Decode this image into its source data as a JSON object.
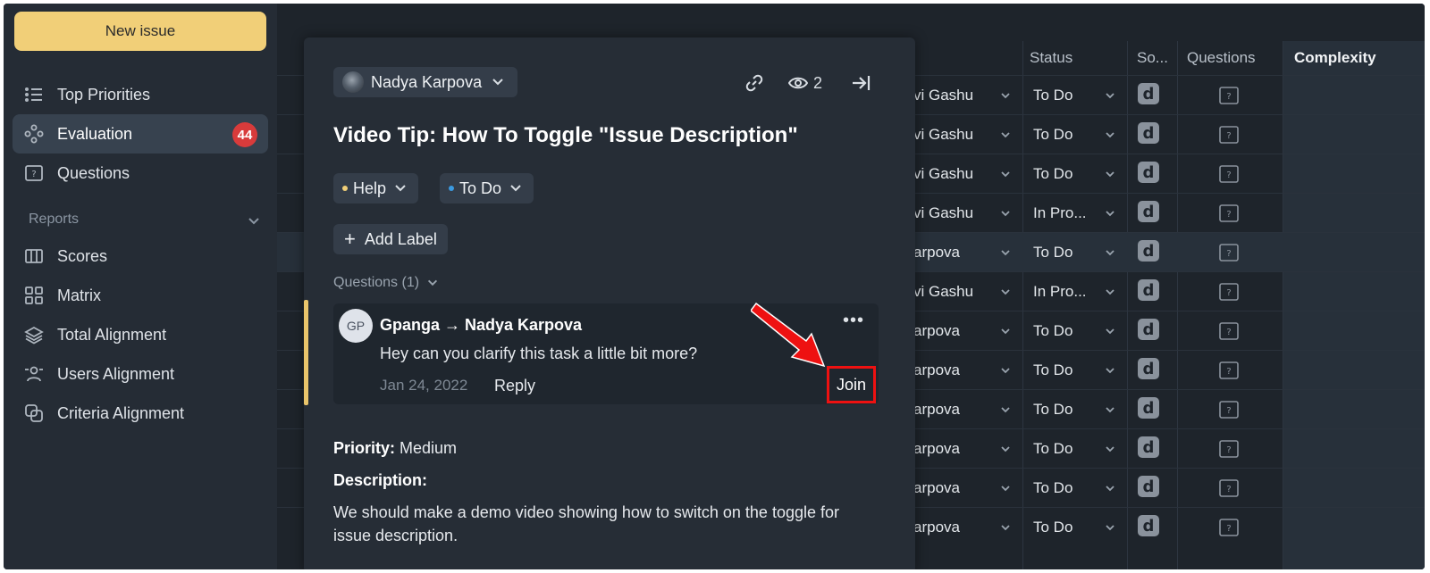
{
  "sidebar": {
    "new_issue_label": "New issue",
    "items": [
      {
        "label": "Top Priorities",
        "icon": "list-icon"
      },
      {
        "label": "Evaluation",
        "icon": "gamepad-icon",
        "badge": "44",
        "active": true
      },
      {
        "label": "Questions",
        "icon": "question-box-icon"
      }
    ],
    "reports_label": "Reports",
    "report_items": [
      {
        "label": "Scores",
        "icon": "columns-icon"
      },
      {
        "label": "Matrix",
        "icon": "grid-icon"
      },
      {
        "label": "Total Alignment",
        "icon": "layers-icon"
      },
      {
        "label": "Users Alignment",
        "icon": "users-icon"
      },
      {
        "label": "Criteria Alignment",
        "icon": "overlap-icon"
      }
    ]
  },
  "table": {
    "headers": {
      "status": "Status",
      "source": "So...",
      "questions": "Questions",
      "complexity": "Complexity"
    },
    "rows": [
      {
        "assignee": "vi Gashu",
        "status": "To Do",
        "source": "d"
      },
      {
        "assignee": "vi Gashu",
        "status": "To Do",
        "source": "d"
      },
      {
        "assignee": "vi Gashu",
        "status": "To Do",
        "source": "d"
      },
      {
        "assignee": "vi Gashu",
        "status": "In Pro...",
        "source": "d"
      },
      {
        "assignee": "arpova",
        "status": "To Do",
        "source": "d",
        "highlight": true
      },
      {
        "assignee": "vi Gashu",
        "status": "In Pro...",
        "source": "d"
      },
      {
        "assignee": "arpova",
        "status": "To Do",
        "source": "d"
      },
      {
        "assignee": "arpova",
        "status": "To Do",
        "source": "d"
      },
      {
        "assignee": "arpova",
        "status": "To Do",
        "source": "d"
      },
      {
        "assignee": "arpova",
        "status": "To Do",
        "source": "d"
      },
      {
        "assignee": "arpova",
        "status": "To Do",
        "source": "d"
      },
      {
        "assignee": "arpova",
        "status": "To Do",
        "source": "d"
      }
    ]
  },
  "panel": {
    "assignee_name": "Nadya Karpova",
    "watchers_count": "2",
    "title": "Video Tip: How To Toggle \"Issue Description\"",
    "type_label": "Help",
    "status_label": "To Do",
    "add_label": "Add Label",
    "questions_toggle": "Questions (1)",
    "comment": {
      "avatar_initials": "GP",
      "author": "Gpanga → Nadya Karpova",
      "more": "•••",
      "text": "Hey can you clarify this task a little bit more?",
      "date": "Jan 24, 2022",
      "reply_label": "Reply",
      "join_label": "Join"
    },
    "priority_label": "Priority:",
    "priority_value": "Medium",
    "description_label": "Description:",
    "description_line1": "We should make a demo video showing how to switch on the toggle for",
    "description_line2": "issue description."
  },
  "colors": {
    "accent_yellow": "#f1cf78",
    "badge_red": "#d83b3b",
    "annotation_red": "#ee1111",
    "help_dot": "#f1cf78",
    "todo_dot": "#3b9ae1"
  }
}
